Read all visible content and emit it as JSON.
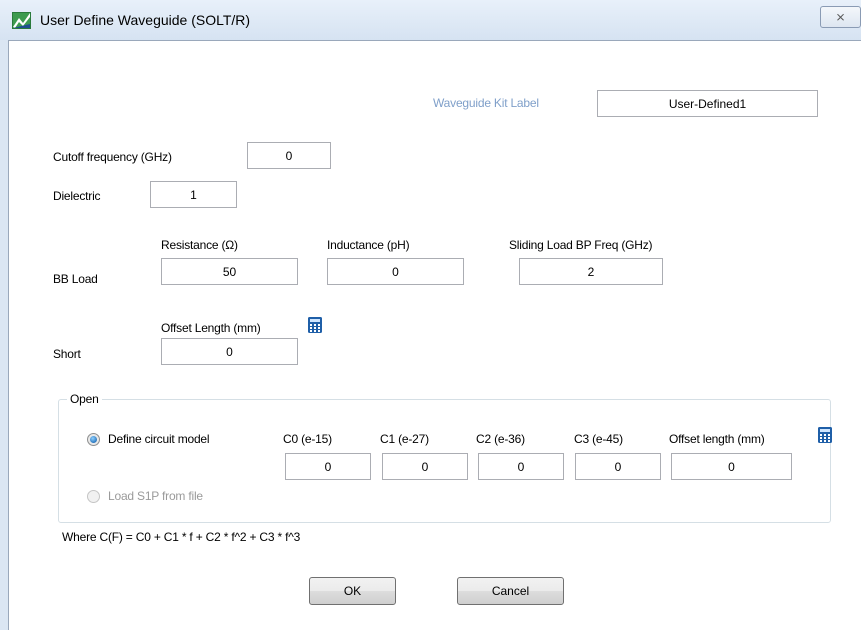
{
  "window": {
    "title": "User Define Waveguide (SOLT/R)",
    "close_glyph": "⨯"
  },
  "kit": {
    "label": "Waveguide Kit Label",
    "value": "User-Defined1"
  },
  "cutoff": {
    "label": "Cutoff frequency (GHz)",
    "value": "0"
  },
  "dielectric": {
    "label": "Dielectric",
    "value": "1"
  },
  "bb_load": {
    "label": "BB Load",
    "resistance_label": "Resistance (Ω)",
    "resistance_value": "50",
    "inductance_label": "Inductance (pH)",
    "inductance_value": "0",
    "sliding_label": "Sliding Load BP Freq (GHz)",
    "sliding_value": "2"
  },
  "short": {
    "label": "Short",
    "offset_label": "Offset Length (mm)",
    "offset_value": "0"
  },
  "open": {
    "group_label": "Open",
    "define_model_label": "Define circuit model",
    "define_model_checked": true,
    "load_s1p_label": "Load S1P from file",
    "load_s1p_enabled": false,
    "c0_label": "C0 (e-15)",
    "c0_value": "0",
    "c1_label": "C1 (e-27)",
    "c1_value": "0",
    "c2_label": "C2 (e-36)",
    "c2_value": "0",
    "c3_label": "C3 (e-45)",
    "c3_value": "0",
    "offset_label": "Offset length (mm)",
    "offset_value": "0"
  },
  "formula": "Where C(F) = C0 + C1 * f + C2 * f^2 + C3 * f^3",
  "buttons": {
    "ok": "OK",
    "cancel": "Cancel"
  },
  "icons": {
    "app": "keysight-logo-icon",
    "calculator": "calculator-icon",
    "close": "close-icon"
  },
  "colors": {
    "title_bar": "#d6e3f2",
    "disabled_text": "#9a9a9a",
    "kit_label": "#7f9fc9",
    "radio_selected": "#1d6bb5"
  }
}
